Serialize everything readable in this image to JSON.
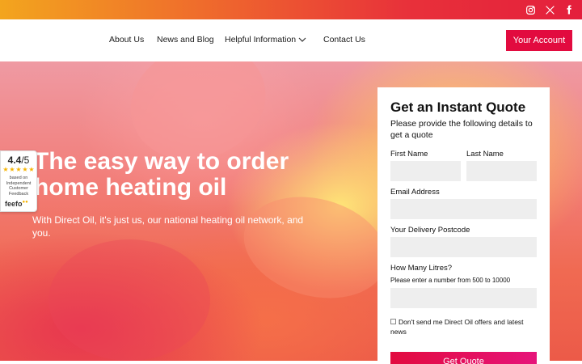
{
  "topbar": {
    "social": [
      {
        "icon": "instagram-icon"
      },
      {
        "icon": "x-icon"
      },
      {
        "icon": "facebook-icon"
      }
    ],
    "gradient": [
      "#f3a51e",
      "#e41f3c"
    ]
  },
  "nav": {
    "items": [
      "About Us",
      "News and Blog",
      "Helpful Information",
      "Contact Us"
    ],
    "account_button": "Your Account",
    "accent": "#e20b3f"
  },
  "hero": {
    "title": "The easy way to order home heating oil",
    "subtitle": "With Direct Oil, it's just us, our national heating oil network, and you."
  },
  "feefo": {
    "score": "4.4",
    "out_of": "/5",
    "stars": 5,
    "caption": "based on Independent Customer Feedback",
    "logo": "feefo"
  },
  "quote": {
    "title": "Get an Instant Quote",
    "description": "Please provide the following details to get a quote",
    "first_name_label": "First Name",
    "last_name_label": "Last Name",
    "email_label": "Email Address",
    "postcode_label": "Your Delivery Postcode",
    "litres_label": "How Many Litres?",
    "litres_hint": "Please enter a number from 500 to 10000",
    "offers_checkbox_label": "Don't send me Direct Oil offers and latest news",
    "submit_label": "Get Quote"
  }
}
